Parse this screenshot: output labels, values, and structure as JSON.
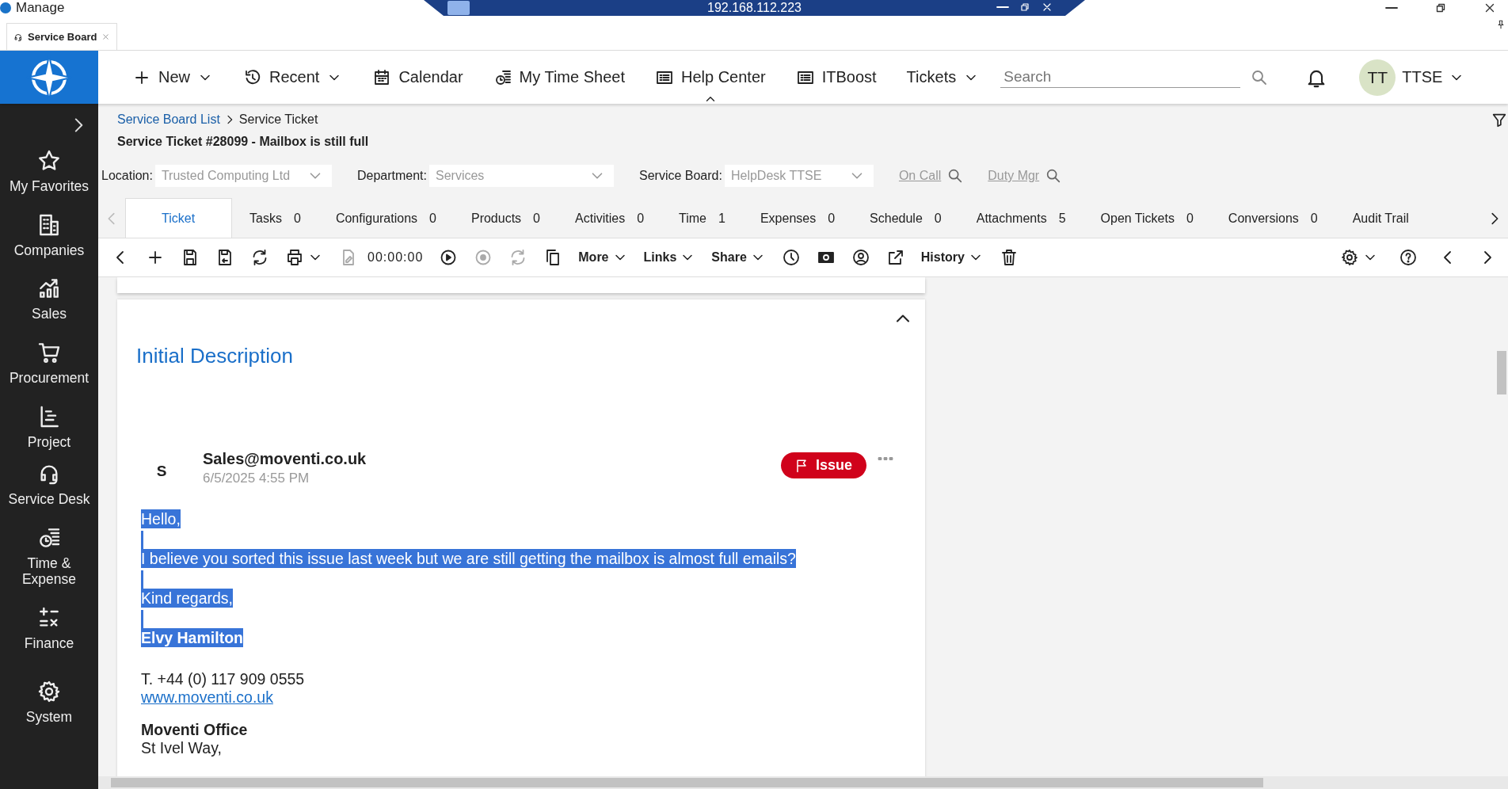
{
  "window": {
    "app_name": "Manage",
    "remote_address": "192.168.112.223"
  },
  "browser_tabs": [
    {
      "label": "Service Board",
      "selected": true
    }
  ],
  "nav": {
    "items": [
      {
        "label": "New",
        "dropdown": true,
        "expanded": false
      },
      {
        "label": "Recent",
        "dropdown": true,
        "expanded": false
      },
      {
        "label": "Calendar",
        "dropdown": false,
        "expanded": false
      },
      {
        "label": "My Time Sheet",
        "dropdown": false,
        "expanded": false
      },
      {
        "label": "Help Center",
        "dropdown": false,
        "expanded": true
      },
      {
        "label": "ITBoost",
        "dropdown": false,
        "expanded": false
      },
      {
        "label": "Tickets",
        "dropdown": true,
        "expanded": false
      }
    ],
    "search": {
      "placeholder": "Search"
    },
    "user": {
      "initials": "TT",
      "name": "TTSE"
    }
  },
  "sidebar": {
    "items": [
      {
        "label": "My Favorites"
      },
      {
        "label": "Companies"
      },
      {
        "label": "Sales"
      },
      {
        "label": "Procurement"
      },
      {
        "label": "Project"
      },
      {
        "label": "Service Desk"
      },
      {
        "label": "Time & Expense"
      },
      {
        "label": "Finance"
      },
      {
        "label": "System"
      }
    ]
  },
  "header": {
    "breadcrumb": [
      "Service Board List",
      "Service Ticket"
    ],
    "title": "Service Ticket #28099 - Mailbox is still full",
    "fields": [
      {
        "label": "Location:",
        "value": "Trusted Computing Ltd"
      },
      {
        "label": "Department:",
        "value": "Services"
      },
      {
        "label": "Service Board:",
        "value": "HelpDesk TTSE"
      }
    ],
    "lookups": [
      "On Call",
      "Duty Mgr"
    ]
  },
  "tabs": [
    {
      "label": "Ticket",
      "selected": true
    },
    {
      "label": "Tasks",
      "count": "0",
      "selected": false
    },
    {
      "label": "Configurations",
      "count": "0",
      "selected": false
    },
    {
      "label": "Products",
      "count": "0",
      "selected": false
    },
    {
      "label": "Activities",
      "count": "0",
      "selected": false
    },
    {
      "label": "Time",
      "count": "1",
      "selected": false
    },
    {
      "label": "Expenses",
      "count": "0",
      "selected": false
    },
    {
      "label": "Schedule",
      "count": "0",
      "selected": false
    },
    {
      "label": "Attachments",
      "count": "5",
      "selected": false
    },
    {
      "label": "Open Tickets",
      "count": "0",
      "selected": false
    },
    {
      "label": "Conversions",
      "count": "0",
      "selected": false
    },
    {
      "label": "Audit Trail",
      "selected": false
    }
  ],
  "toolbar": {
    "left": [
      {
        "kind": "icon",
        "disabled": false
      },
      {
        "kind": "icon",
        "disabled": false
      },
      {
        "kind": "icon",
        "disabled": false
      },
      {
        "kind": "icon",
        "disabled": false
      },
      {
        "kind": "icon",
        "disabled": false
      },
      {
        "kind": "icon",
        "disabled": false
      },
      {
        "kind": "icon",
        "disabled": true
      },
      {
        "kind": "timer",
        "label": "00:00:00"
      },
      {
        "kind": "icon",
        "disabled": false
      },
      {
        "kind": "icon",
        "disabled": true
      },
      {
        "kind": "icon",
        "disabled": true
      },
      {
        "kind": "icon",
        "disabled": false
      },
      {
        "kind": "menu",
        "label": "More"
      },
      {
        "kind": "menu",
        "label": "Links"
      },
      {
        "kind": "menu",
        "label": "Share"
      },
      {
        "kind": "icon",
        "disabled": false
      },
      {
        "kind": "icon",
        "disabled": false
      },
      {
        "kind": "icon",
        "disabled": false
      },
      {
        "kind": "icon",
        "disabled": false
      },
      {
        "kind": "menu",
        "label": "History"
      },
      {
        "kind": "icon",
        "disabled": false
      }
    ],
    "right": [
      {
        "kind": "icon",
        "disabled": false
      },
      {
        "kind": "icon",
        "disabled": false
      },
      {
        "kind": "icon",
        "disabled": false
      },
      {
        "kind": "icon",
        "disabled": false
      }
    ]
  },
  "description": {
    "title": "Initial Description",
    "expanded": true,
    "message": {
      "avatar": "S",
      "sender": "Sales@moventi.co.uk",
      "date": "6/5/2025 4:55 PM",
      "tag": "Issue",
      "body": [
        {
          "text": "Hello,",
          "bold": false,
          "selected": true
        },
        {
          "text": "I believe you sorted this issue last week but we are still getting the mailbox is almost full emails?",
          "bold": false,
          "selected": true
        },
        {
          "text": "Kind regards,",
          "bold": false,
          "selected": true
        },
        {
          "text": "Elvy Hamilton",
          "bold": true,
          "selected": true
        }
      ],
      "phone": "T. +44 (0) 117 909 0555",
      "link": "www.moventi.co.uk",
      "office": "Moventi Office",
      "address": "St Ivel Way,"
    }
  }
}
